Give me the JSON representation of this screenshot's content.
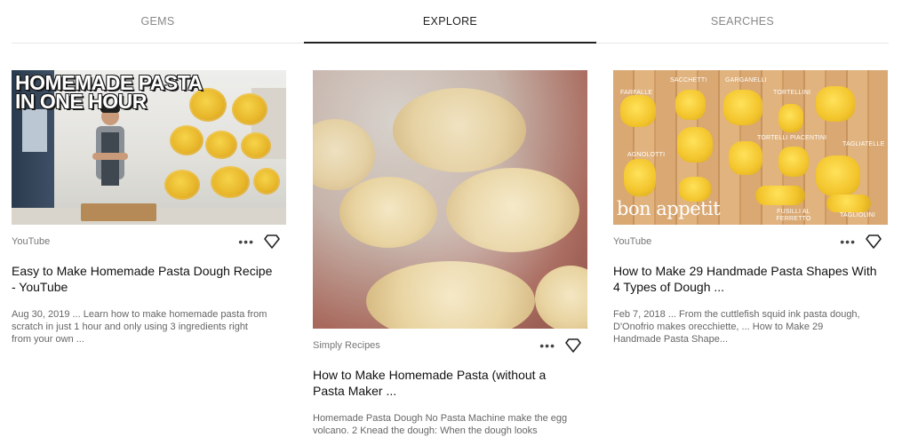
{
  "tabs": [
    {
      "label": "GEMS",
      "active": false
    },
    {
      "label": "EXPLORE",
      "active": true
    },
    {
      "label": "SEARCHES",
      "active": false
    }
  ],
  "cards": [
    {
      "source": "YouTube",
      "title": "Easy to Make Homemade Pasta Dough Recipe - YouTube",
      "snippet": "Aug 30, 2019 ... Learn how to make homemade pasta from scratch in just 1 hour and only using 3 ingredients right from your own ...",
      "image_text": "HOMEMADE PASTA IN ONE HOUR"
    },
    {
      "source": "Simply Recipes",
      "title": "How to Make Homemade Pasta (without a Pasta Maker ...",
      "snippet": "Homemade Pasta Dough No Pasta Machine make the egg volcano. 2 Knead the dough: When the dough looks"
    },
    {
      "source": "YouTube",
      "title": "How to Make 29 Handmade Pasta Shapes With 4 Types of Dough ...",
      "snippet": "Feb 7, 2018 ... From the cuttlefish squid ink pasta dough, D'Onofrio makes orecchiette, ... How to Make 29 Handmade Pasta Shape...",
      "image_brand": "bon appetit",
      "image_labels": [
        "FARFALLE",
        "SACCHETTI",
        "GARGANELLI",
        "TORTELLINI",
        "AGNOLOTTI",
        "TORTELLI PIACENTINI",
        "TAGLIATELLE",
        "FUSILLI AL FERRETTO",
        "TAGLIOLINI"
      ]
    }
  ],
  "icons": {
    "more": "more-horizontal-icon",
    "gem": "gem-icon"
  },
  "more_glyph": "•••"
}
